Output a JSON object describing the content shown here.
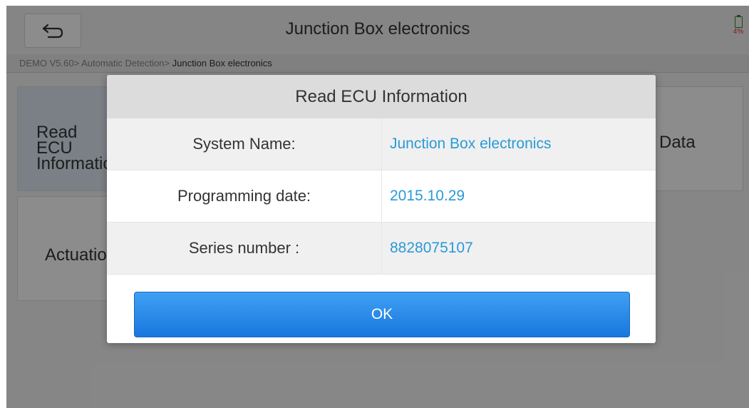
{
  "header": {
    "title": "Junction Box electronics",
    "battery_percent": "4%"
  },
  "breadcrumb": {
    "path": "DEMO V5.60> Automatic Detection> ",
    "current": "Junction Box electronics"
  },
  "tiles": [
    {
      "label": "Read ECU Information"
    },
    {
      "label": "Actuation"
    },
    {
      "label": "Data"
    }
  ],
  "dialog": {
    "title": "Read ECU Information",
    "rows": [
      {
        "label": "System Name:",
        "value": "Junction Box electronics"
      },
      {
        "label": "Programming date:",
        "value": "2015.10.29"
      },
      {
        "label": "Series number :",
        "value": "8828075107"
      }
    ],
    "ok_label": "OK"
  },
  "colors": {
    "accent": "#2a9ad6",
    "button": "#1877de",
    "battery_low": "#e53935"
  },
  "icons": {
    "back": "back-arrow-icon",
    "battery": "battery-icon"
  }
}
